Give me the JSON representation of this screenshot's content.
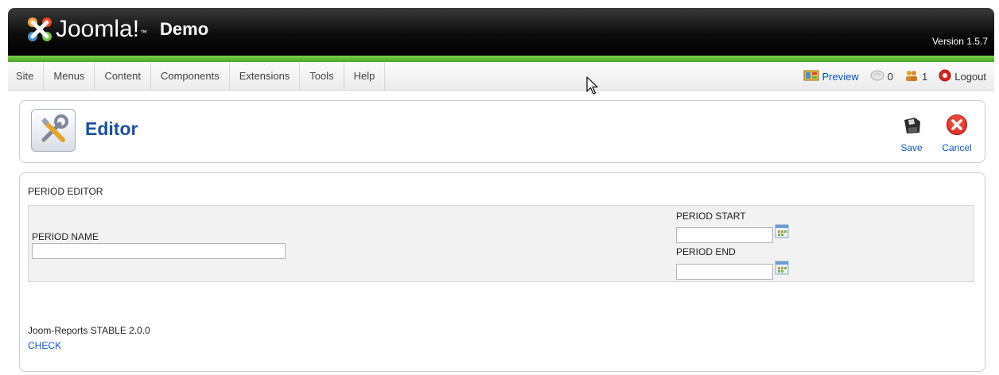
{
  "header": {
    "logo_text": "Joomla!",
    "logo_tm": "™",
    "site_label": "Demo",
    "version": "Version 1.5.7"
  },
  "menu": {
    "items": [
      "Site",
      "Menus",
      "Content",
      "Components",
      "Extensions",
      "Tools",
      "Help"
    ]
  },
  "status": {
    "preview_label": "Preview",
    "messages_count": "0",
    "users_count": "1",
    "logout_label": "Logout"
  },
  "toolbar": {
    "title": "Editor",
    "save_label": "Save",
    "cancel_label": "Cancel"
  },
  "form": {
    "section_title": "PERIOD EDITOR",
    "period_name_label": "PERIOD NAME",
    "period_name_value": "",
    "period_start_label": "PERIOD START",
    "period_start_value": "",
    "period_end_label": "PERIOD END",
    "period_end_value": ""
  },
  "footer": {
    "version_text": "Joom-Reports STABLE 2.0.0",
    "check_link": "CHECK"
  },
  "colors": {
    "accent_green": "#5cb832",
    "title_blue": "#1a4fa8",
    "link_blue": "#0b55c4",
    "cancel_red": "#d8231d"
  }
}
